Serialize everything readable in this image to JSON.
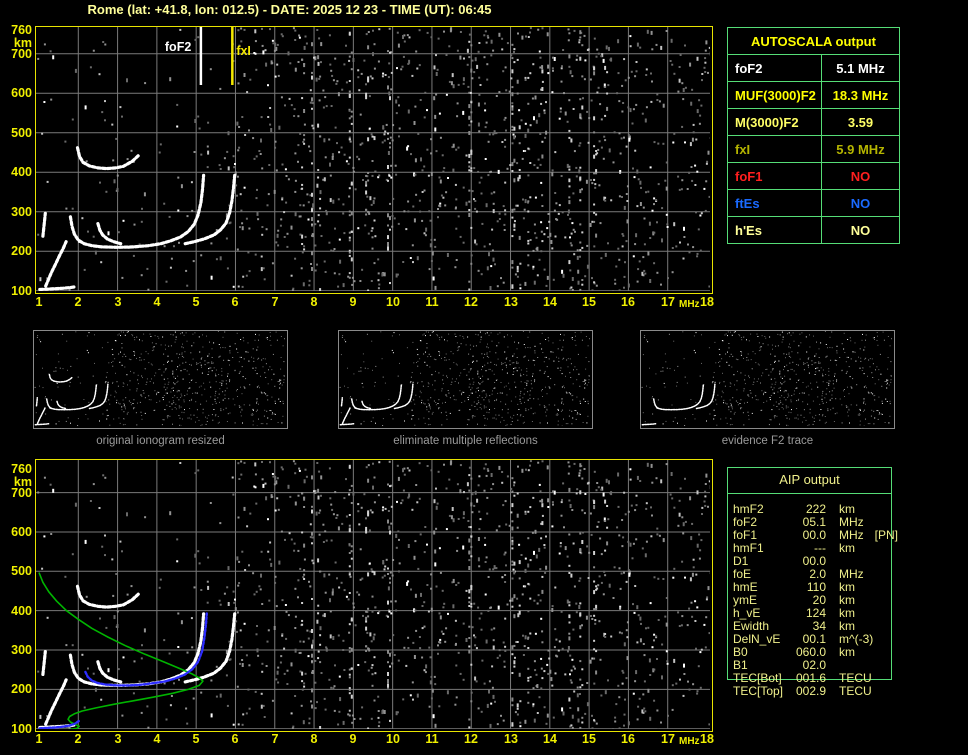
{
  "title": "Rome (lat: +41.8, lon: 012.5) - DATE: 2025 12 23 - TIME (UT): 06:45",
  "colors": {
    "background": "#000000",
    "plot_border": "#e8e400",
    "grid": "#7a7a7a",
    "axis_text": "#f0f000",
    "title_text": "#ffff99",
    "table_border": "#55dd77",
    "trace_white": "#ffffff",
    "profile_green": "#00b400",
    "restored_blue": "#2d2dff",
    "fof2_marker": "#ffffff",
    "fxi_marker": "#f5e900",
    "thumb_border": "#8a8a8a",
    "caption_text": "#9a9a9a",
    "aip_text": "#f0f08c"
  },
  "autoscala": {
    "header": "AUTOSCALA output",
    "rows": [
      {
        "label": "foF2",
        "value": "5.1 MHz",
        "color": "#ffffff"
      },
      {
        "label": "MUF(3000)F2",
        "value": "18.3 MHz",
        "color": "#ffff00"
      },
      {
        "label": "M(3000)F2",
        "value": "3.59",
        "color": "#ffff66"
      },
      {
        "label": "fxI",
        "value": "5.9 MHz",
        "color": "#b5b500"
      },
      {
        "label": "foF1",
        "value": "NO",
        "color": "#ff1f1f"
      },
      {
        "label": "ftEs",
        "value": "NO",
        "color": "#1a6aff"
      },
      {
        "label": "h'Es",
        "value": "NO",
        "color": "#ffff99"
      }
    ]
  },
  "aip": {
    "header": "AIP output",
    "rows": [
      {
        "label": "hmF2",
        "value": "222",
        "unit": "km",
        "extra": ""
      },
      {
        "label": "foF2",
        "value": "05.1",
        "unit": "MHz",
        "extra": ""
      },
      {
        "label": "foF1",
        "value": "00.0",
        "unit": "MHz",
        "extra": "[PN]"
      },
      {
        "label": "hmF1",
        "value": "---",
        "unit": "km",
        "extra": ""
      },
      {
        "label": "D1",
        "value": "00.0",
        "unit": "",
        "extra": ""
      },
      {
        "label": "foE",
        "value": "2.0",
        "unit": "MHz",
        "extra": ""
      },
      {
        "label": "hmE",
        "value": "110",
        "unit": "km",
        "extra": ""
      },
      {
        "label": "ymE",
        "value": "20",
        "unit": "km",
        "extra": ""
      },
      {
        "label": "h_vE",
        "value": "124",
        "unit": "km",
        "extra": ""
      },
      {
        "label": "Ewidth",
        "value": "34",
        "unit": "km",
        "extra": ""
      },
      {
        "label": "DelN_vE",
        "value": "00.1",
        "unit": "m^(-3)",
        "extra": ""
      },
      {
        "label": "B0",
        "value": "060.0",
        "unit": "km",
        "extra": ""
      },
      {
        "label": "B1",
        "value": "02.0",
        "unit": "",
        "extra": ""
      },
      {
        "label": "TEC[Bot]",
        "value": "001.6",
        "unit": "TECU",
        "extra": ""
      },
      {
        "label": "TEC[Top]",
        "value": "002.9",
        "unit": "TECU",
        "extra": ""
      }
    ]
  },
  "thumbnails": [
    {
      "caption": "original ionogram resized"
    },
    {
      "caption": "eliminate multiple reflections"
    },
    {
      "caption": "evidence F2 trace"
    }
  ],
  "chart_data": {
    "type": "scatter",
    "title": "ionogram",
    "xlabel": "MHz",
    "ylabel": "km",
    "xlim": [
      1,
      18
    ],
    "ylim": [
      100,
      760
    ],
    "xticks": [
      1,
      2,
      3,
      4,
      5,
      6,
      7,
      8,
      9,
      10,
      11,
      12,
      13,
      14,
      15,
      16,
      17,
      18
    ],
    "yticks": [
      760,
      700,
      600,
      500,
      400,
      300,
      200,
      100
    ],
    "markers": {
      "foF2_MHz": 5.1,
      "fxI_MHz": 5.9
    },
    "traces": {
      "second_hop": [
        [
          1.98,
          462
        ],
        [
          2.03,
          440
        ],
        [
          2.12,
          425
        ],
        [
          2.28,
          416
        ],
        [
          2.5,
          411
        ],
        [
          2.72,
          409
        ],
        [
          2.95,
          411
        ],
        [
          3.15,
          415
        ],
        [
          3.38,
          428
        ],
        [
          3.55,
          444
        ]
      ],
      "f_main": [
        [
          1.8,
          287
        ],
        [
          1.84,
          263
        ],
        [
          1.9,
          243
        ],
        [
          2.0,
          228
        ],
        [
          2.15,
          219
        ],
        [
          2.35,
          214
        ],
        [
          2.6,
          211
        ],
        [
          3.0,
          210
        ],
        [
          3.4,
          211
        ],
        [
          3.78,
          214
        ],
        [
          4.1,
          219
        ],
        [
          4.35,
          226
        ],
        [
          4.6,
          236
        ],
        [
          4.8,
          250
        ],
        [
          4.95,
          268
        ],
        [
          5.05,
          292
        ],
        [
          5.12,
          323
        ],
        [
          5.16,
          356
        ],
        [
          5.19,
          392
        ]
      ],
      "x_cusp": [
        [
          2.5,
          270
        ],
        [
          2.55,
          253
        ],
        [
          2.62,
          241
        ],
        [
          2.74,
          231
        ],
        [
          2.9,
          224
        ],
        [
          3.08,
          219
        ]
      ],
      "x_rise": [
        [
          4.72,
          219
        ],
        [
          4.95,
          224
        ],
        [
          5.2,
          231
        ],
        [
          5.45,
          241
        ],
        [
          5.62,
          254
        ],
        [
          5.76,
          271
        ],
        [
          5.85,
          297
        ],
        [
          5.91,
          327
        ],
        [
          5.95,
          360
        ],
        [
          5.98,
          392
        ]
      ],
      "lower_diag": [
        [
          1.17,
          112
        ],
        [
          1.24,
          128
        ],
        [
          1.32,
          147
        ],
        [
          1.42,
          167
        ],
        [
          1.52,
          188
        ],
        [
          1.62,
          208
        ],
        [
          1.69,
          224
        ]
      ],
      "left_seg": [
        [
          1.1,
          238
        ],
        [
          1.12,
          257
        ],
        [
          1.14,
          276
        ],
        [
          1.16,
          296
        ]
      ],
      "e_seg": [
        [
          1.02,
          103
        ],
        [
          1.2,
          104
        ],
        [
          1.4,
          105
        ],
        [
          1.6,
          106
        ],
        [
          1.8,
          108
        ],
        [
          1.93,
          110
        ]
      ]
    },
    "profile_green": [
      [
        1.0,
        497
      ],
      [
        1.1,
        472
      ],
      [
        1.25,
        448
      ],
      [
        1.45,
        424
      ],
      [
        1.7,
        400
      ],
      [
        2.0,
        378
      ],
      [
        2.35,
        355
      ],
      [
        2.75,
        333
      ],
      [
        3.2,
        311
      ],
      [
        3.7,
        289
      ],
      [
        4.2,
        269
      ],
      [
        4.6,
        252
      ],
      [
        4.9,
        239
      ],
      [
        5.08,
        229
      ],
      [
        5.17,
        221
      ],
      [
        5.08,
        210
      ],
      [
        4.8,
        200
      ],
      [
        4.4,
        190
      ],
      [
        3.9,
        180
      ],
      [
        3.4,
        171
      ],
      [
        2.9,
        162
      ],
      [
        2.45,
        153
      ],
      [
        2.1,
        145
      ],
      [
        1.9,
        138
      ],
      [
        1.78,
        131
      ],
      [
        1.74,
        124
      ],
      [
        1.8,
        117
      ],
      [
        1.92,
        111
      ],
      [
        2.02,
        106
      ],
      [
        1.97,
        101
      ],
      [
        1.78,
        98
      ],
      [
        1.5,
        97
      ],
      [
        1.2,
        98
      ],
      [
        1.02,
        99
      ]
    ],
    "restored_blue": [
      [
        [
          1.02,
          101
        ],
        [
          1.2,
          102
        ],
        [
          1.4,
          103
        ],
        [
          1.6,
          105
        ],
        [
          1.78,
          108
        ],
        [
          1.92,
          113
        ],
        [
          2.02,
          120
        ]
      ],
      [
        [
          2.18,
          244
        ],
        [
          2.24,
          232
        ],
        [
          2.35,
          222
        ],
        [
          2.5,
          216
        ],
        [
          2.7,
          212
        ],
        [
          3.0,
          210
        ],
        [
          3.3,
          210
        ],
        [
          3.62,
          212
        ],
        [
          3.92,
          216
        ],
        [
          4.2,
          220
        ],
        [
          4.45,
          227
        ],
        [
          4.7,
          237
        ],
        [
          4.9,
          251
        ],
        [
          5.05,
          270
        ],
        [
          5.15,
          297
        ],
        [
          5.21,
          331
        ],
        [
          5.25,
          366
        ],
        [
          5.27,
          393
        ]
      ]
    ],
    "noise": {
      "seed": 7,
      "dots": 1500,
      "streak_columns": 16
    }
  }
}
